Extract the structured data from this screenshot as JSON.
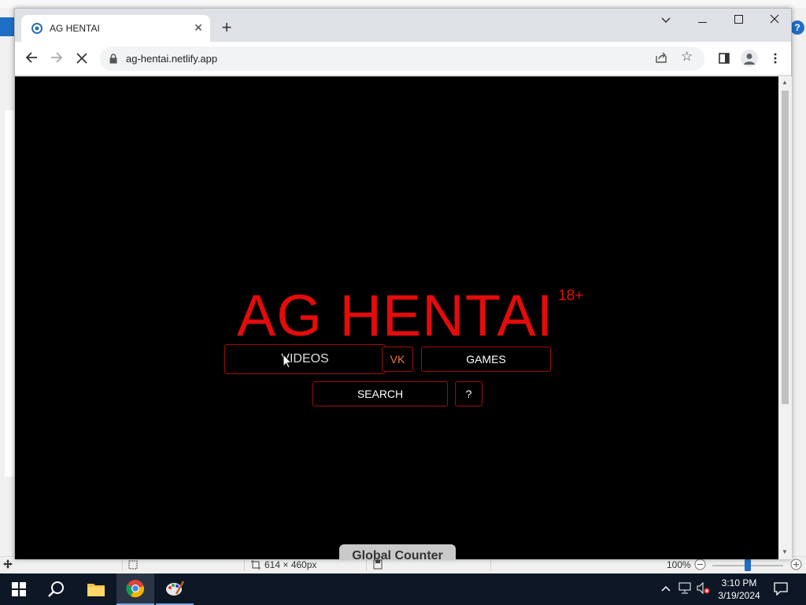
{
  "paint": {
    "status_size": "614 × 460px",
    "zoom": "100%"
  },
  "browser": {
    "tab_title": "AG HENTAI",
    "url": "ag-hentai.netlify.app"
  },
  "site": {
    "title": "AG HENTAI",
    "age_badge": "18+",
    "buttons": {
      "videos": "VIDEOS",
      "vk": "VK",
      "games": "GAMES",
      "search": "SEARCH",
      "help": "?"
    },
    "footer": "Global Counter"
  },
  "taskbar": {
    "time": "3:10 PM",
    "date": "3/19/2024"
  },
  "colors": {
    "accent_red": "#e30b0b",
    "vk_orange": "#f27a3a"
  }
}
